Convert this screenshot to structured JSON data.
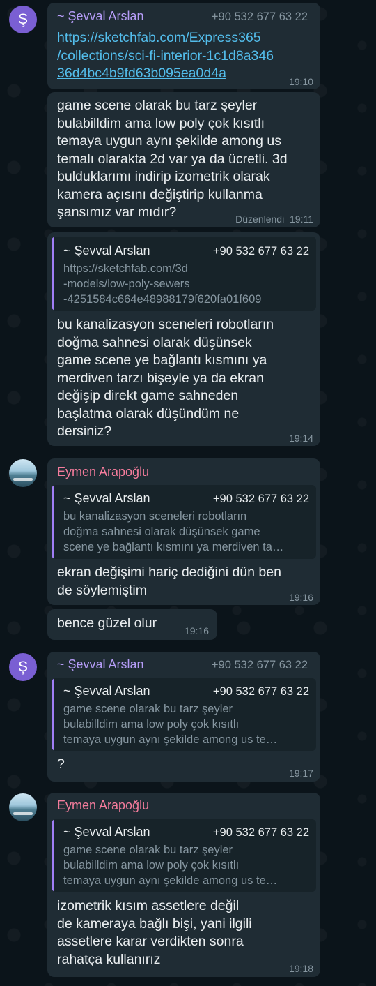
{
  "messages": [
    {
      "sender": "~ Şevval Arslan",
      "phone": "+90 532 677 63 22",
      "avatar_letter": "Ş",
      "link_lines": [
        "https://sketchfab.com/Express365",
        "/collections/sci-fi-interior-1c1d8a346",
        "36d4bc4b9fd63b095ea0d4a"
      ],
      "time": "19:10"
    },
    {
      "text_lines": [
        "game scene olarak bu tarz şeyler",
        "bulabilldim ama low poly çok kısıtlı",
        "temaya uygun aynı şekilde among us",
        "temalı olarakta 2d var ya da ücretli. 3d",
        "bulduklarımı indirip izometrik olarak",
        "kamera açısını değiştirip kullanma",
        "şansımız var mıdır?"
      ],
      "edited": "Düzenlendi",
      "time": "19:11"
    },
    {
      "quote": {
        "sender": "~ Şevval Arslan",
        "phone": "+90 532 677 63 22",
        "lines": [
          "https://sketchfab.com/3d",
          "-models/low-poly-sewers",
          "-4251584c664e48988179f620fa01f609"
        ]
      },
      "text_lines": [
        "bu kanalizasyon sceneleri robotların",
        "doğma sahnesi olarak düşünsek",
        "game scene ye bağlantı kısmını ya",
        "merdiven tarzı bişeyle ya da ekran",
        "değişip direkt game sahneden",
        "başlatma olarak düşündüm ne",
        "dersiniz?"
      ],
      "time": "19:14"
    },
    {
      "sender": "Eymen Arapoğlu",
      "quote": {
        "sender": "~ Şevval Arslan",
        "phone": "+90 532 677 63 22",
        "lines": [
          "bu kanalizasyon sceneleri robotların",
          "doğma sahnesi olarak düşünsek game",
          "scene ye bağlantı kısmını ya merdiven ta…"
        ]
      },
      "text_lines": [
        "ekran değişimi hariç dediğini dün ben",
        "de söylemiştim"
      ],
      "time": "19:16"
    },
    {
      "text_lines": [
        "bence güzel olur"
      ],
      "time": "19:16"
    },
    {
      "sender": "~ Şevval Arslan",
      "phone": "+90 532 677 63 22",
      "avatar_letter": "Ş",
      "quote": {
        "sender": "~ Şevval Arslan",
        "phone": "+90 532 677 63 22",
        "lines": [
          "game scene olarak bu tarz şeyler",
          "bulabilldim ama low poly çok kısıtlı",
          "temaya uygun aynı şekilde among us te…"
        ]
      },
      "text_lines": [
        "?"
      ],
      "time": "19:17"
    },
    {
      "sender": "Eymen Arapoğlu",
      "quote": {
        "sender": "~ Şevval Arslan",
        "phone": "+90 532 677 63 22",
        "lines": [
          "game scene olarak bu tarz şeyler",
          "bulabilldim ama low poly çok kısıtlı",
          "temaya uygun aynı şekilde among us te…"
        ]
      },
      "text_lines": [
        "izometrik kısım assetlere değil",
        "de kameraya bağlı bişi, yani ilgili",
        "assetlere karar verdikten sonra",
        "rahatça kullanırız"
      ],
      "time": "19:18"
    }
  ],
  "colors": {
    "background": "#0b141a",
    "bubble": "#1f2c34",
    "quote_background": "#172329",
    "quote_bar": "#a07ef5",
    "sender_purple": "#b69df8",
    "sender_pink": "#f47c9c",
    "link": "#53bdeb",
    "meta_text": "#8696a0"
  },
  "icons": {
    "avatar_photo": "landscape-photo-avatar-icon"
  }
}
